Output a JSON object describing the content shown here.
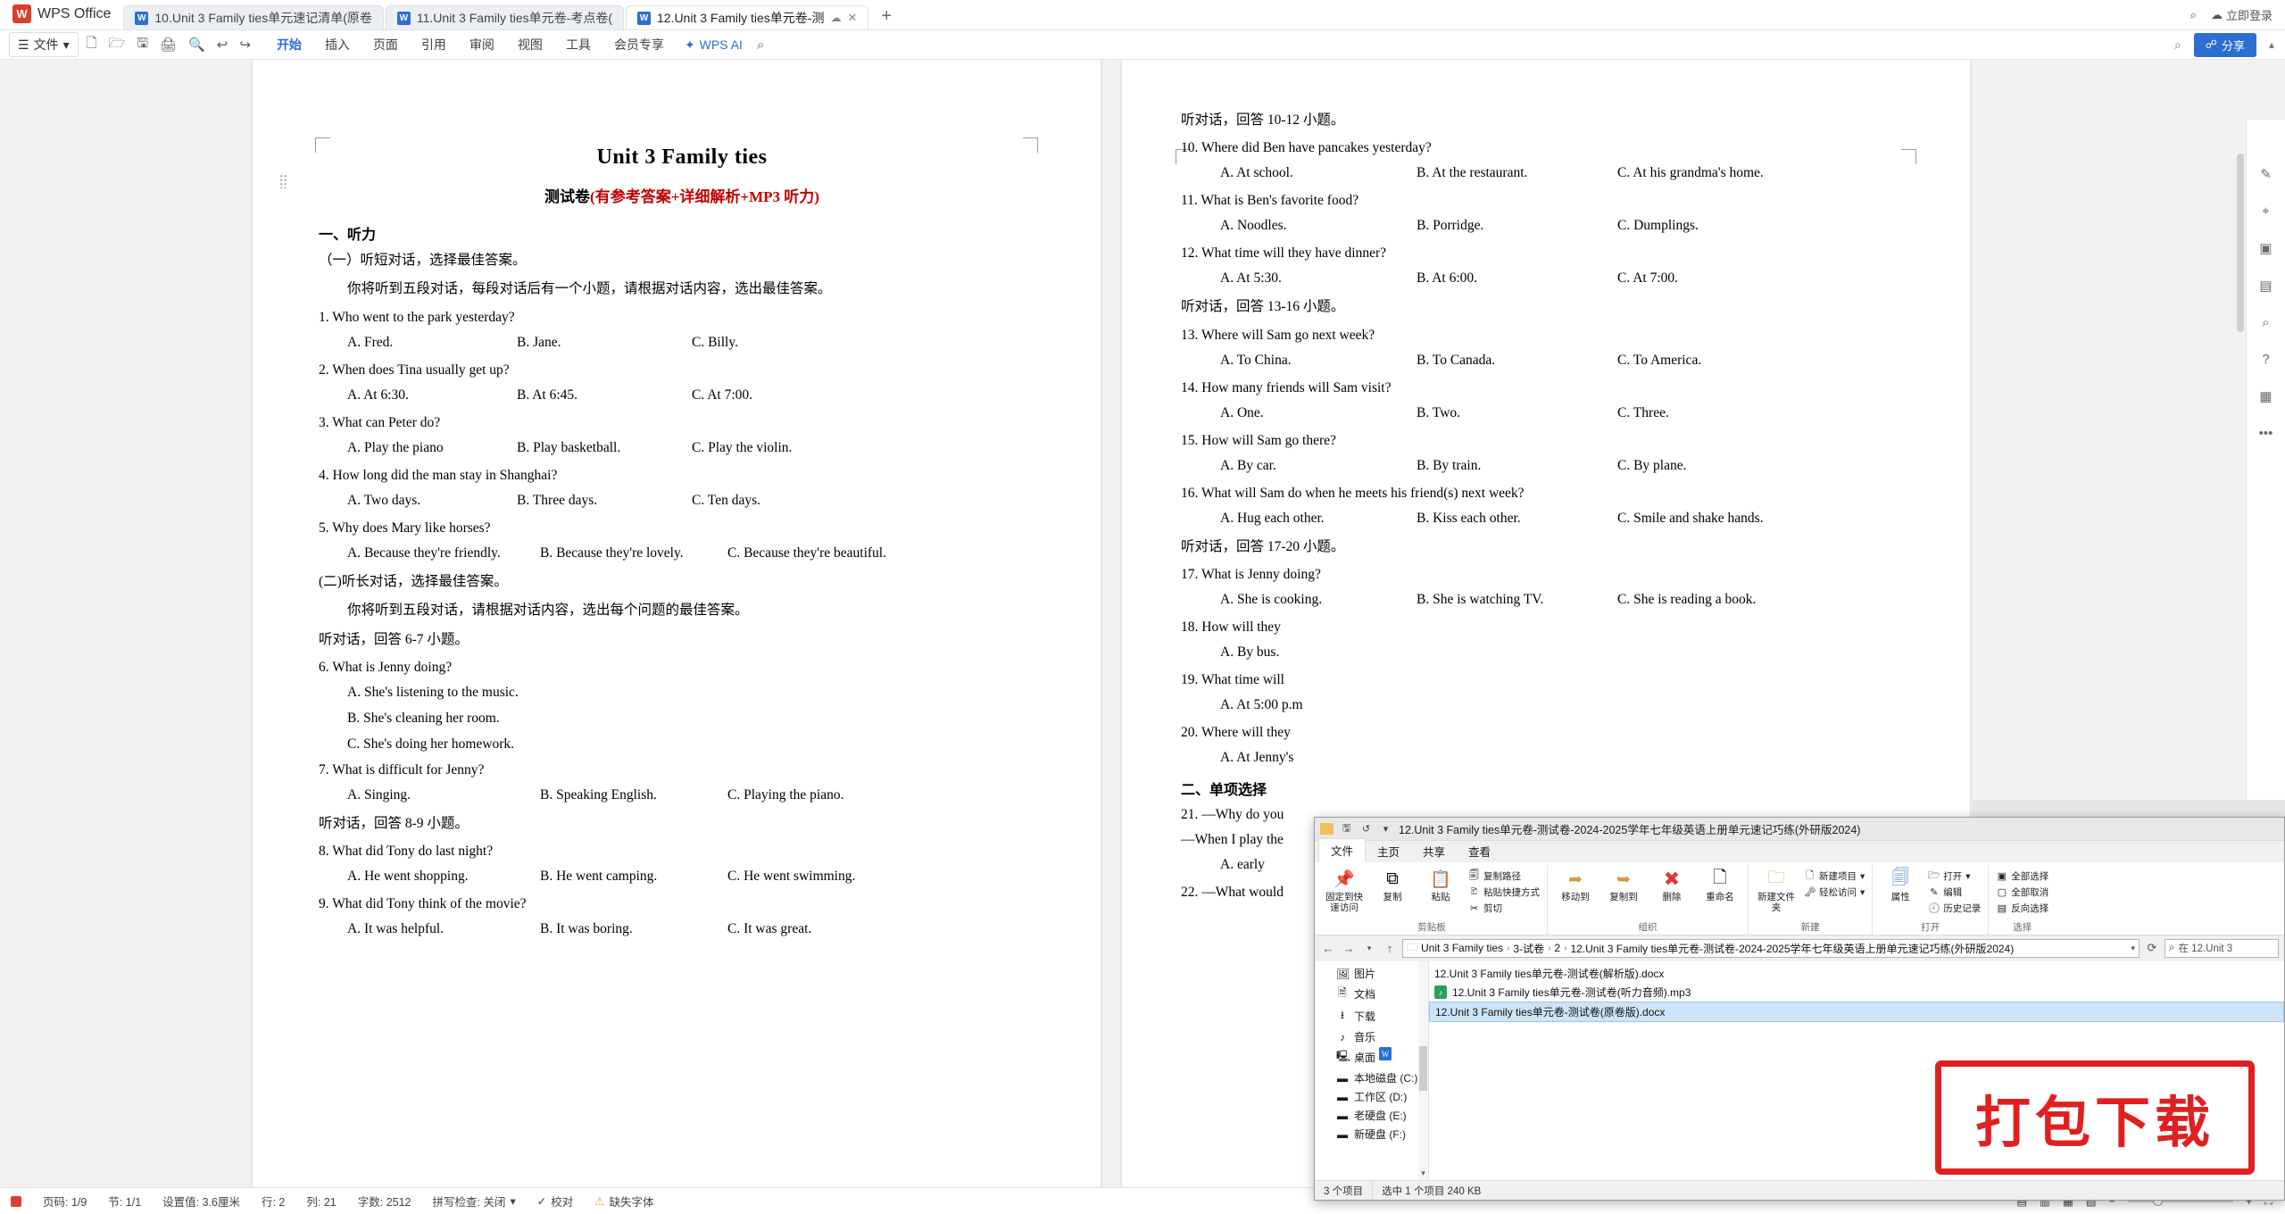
{
  "app": {
    "name": "WPS Office",
    "logo_letter": "W"
  },
  "tabs": [
    {
      "label": "10.Unit 3 Family ties单元速记清单(原卷",
      "icon": "word-doc-icon",
      "active": false
    },
    {
      "label": "11.Unit 3 Family ties单元卷-考点卷(",
      "icon": "word-doc-icon",
      "active": false
    },
    {
      "label": "12.Unit 3 Family ties单元卷-测",
      "icon": "word-doc-icon",
      "active": true
    }
  ],
  "tab_add": "+",
  "titlebar_right": {
    "search_icon": "search-icon",
    "user_icon": "user-icon",
    "upgrade": "立即登录"
  },
  "ribbon": {
    "file_menu": "文件",
    "quick_access": [
      "new-icon",
      "open-icon",
      "save-icon",
      "print-icon",
      "print-preview-icon",
      "undo-icon",
      "redo-icon"
    ],
    "menu_items": [
      {
        "label": "开始",
        "selected": true
      },
      {
        "label": "插入",
        "selected": false
      },
      {
        "label": "页面",
        "selected": false
      },
      {
        "label": "引用",
        "selected": false
      },
      {
        "label": "审阅",
        "selected": false
      },
      {
        "label": "视图",
        "selected": false
      },
      {
        "label": "工具",
        "selected": false
      },
      {
        "label": "会员专享",
        "selected": false
      }
    ],
    "wps_ai": "WPS AI",
    "search_icon": "search-icon",
    "help_icon": "help-icon",
    "share_label": "分享",
    "collapse_icon": "chevron-up-icon"
  },
  "document": {
    "title": "Unit 3 Family ties",
    "subtitle_main": "测试卷",
    "subtitle_paren": "(有参考答案+详细解析+MP3 听力)",
    "section1": "一、听力",
    "part1": "（一）听短对话，选择最佳答案。",
    "part1_note": "你将听到五段对话，每段对话后有一个小题，请根据对话内容，选出最佳答案。",
    "questions_left": [
      {
        "q": "1. Who went to the park yesterday?",
        "a": "A. Fred.",
        "b": "B. Jane.",
        "c": "C. Billy."
      },
      {
        "q": "2. When does Tina usually get up?",
        "a": "A. At 6:30.",
        "b": "B. At 6:45.",
        "c": "C. At 7:00."
      },
      {
        "q": "3. What can Peter do?",
        "a": "A. Play the piano",
        "b": "B. Play basketball.",
        "c": "C. Play the violin."
      },
      {
        "q": "4. How long did the man stay in Shanghai?",
        "a": "A. Two days.",
        "b": "B. Three days.",
        "c": "C. Ten days."
      },
      {
        "q": "5. Why does Mary like horses?",
        "a": "A. Because they're friendly.",
        "b": "B. Because they're lovely.",
        "c": "C. Because they're beautiful."
      }
    ],
    "part2": "(二)听长对话，选择最佳答案。",
    "part2_note": "你将听到五段对话，请根据对话内容，选出每个问题的最佳答案。",
    "listen_6_7": "听对话，回答 6-7 小题。",
    "q6": "6. What is Jenny doing?",
    "q6_a": "A. She's listening to the music.",
    "q6_b": "B. She's cleaning her room.",
    "q6_c": "C. She's doing her homework.",
    "q7": "7. What is difficult for Jenny?",
    "q7_a": "A. Singing.",
    "q7_b": "B. Speaking English.",
    "q7_c": "C. Playing the piano.",
    "listen_8_9": "听对话，回答 8-9 小题。",
    "q8": "8. What did Tony do last night?",
    "q8_a": "A. He went shopping.",
    "q8_b": "B. He went camping.",
    "q8_c": "C. He went swimming.",
    "q9": "9. What did Tony think of the movie?",
    "q9_a": "A. It was helpful.",
    "q9_b": "B. It was boring.",
    "q9_c": "C. It was great."
  },
  "document_right": {
    "listen_10_12": "听对话，回答 10-12 小题。",
    "q10": "10. Where did Ben have pancakes yesterday?",
    "q10_a": "A. At school.",
    "q10_b": "B. At the restaurant.",
    "q10_c": "C. At his grandma's home.",
    "q11": "11. What is Ben's favorite food?",
    "q11_a": "A. Noodles.",
    "q11_b": "B. Porridge.",
    "q11_c": "C. Dumplings.",
    "q12": "12. What time will they have dinner?",
    "q12_a": "A. At 5:30.",
    "q12_b": "B. At 6:00.",
    "q12_c": "C. At 7:00.",
    "listen_13_16": "听对话，回答 13-16 小题。",
    "q13": "13. Where will Sam go next week?",
    "q13_a": "A. To China.",
    "q13_b": "B. To Canada.",
    "q13_c": "C. To America.",
    "q14": "14. How many friends will Sam visit?",
    "q14_a": "A. One.",
    "q14_b": "B. Two.",
    "q14_c": "C. Three.",
    "q15": "15. How will Sam go there?",
    "q15_a": "A. By car.",
    "q15_b": "B. By train.",
    "q15_c": "C. By plane.",
    "q16": "16. What will Sam do when he meets his friend(s) next week?",
    "q16_a": "A. Hug each other.",
    "q16_b": "B. Kiss each other.",
    "q16_c": "C. Smile and shake hands.",
    "listen_17_20": "听对话，回答 17-20 小题。",
    "q17": "17. What is Jenny doing?",
    "q17_a": "A. She is cooking.",
    "q17_b": "B. She is watching TV.",
    "q17_c": "C. She is reading a book.",
    "q18": "18. How will they",
    "q18_a": "A. By bus.",
    "q19": "19. What time will",
    "q19_a": "A. At 5:00 p.m",
    "q20": "20. Where will they",
    "q20_a": "A. At Jenny's",
    "section2": "二、单项选择",
    "q21": "21. —Why do you",
    "q21b": "—When I play the",
    "q21_a": "A. early",
    "q22": "22. —What would"
  },
  "right_rail": {
    "icons": [
      "pen-icon",
      "cursor-icon",
      "comment-icon",
      "layers-icon",
      "find-icon",
      "help-icon",
      "image-icon",
      "more-icon"
    ]
  },
  "statusbar": {
    "page_icon": "page-red-icon",
    "page_label": "页码: 1/9",
    "section": "节: 1/1",
    "position": "设置值: 3.6厘米",
    "row": "行: 2",
    "col": "列: 21",
    "word_count": "字数: 2512",
    "spellcheck": "拼写检查: 关闭",
    "proof": "校对",
    "missing_font": "缺失字体",
    "view_icons": [
      "page-view-icon",
      "web-view-icon",
      "outline-view-icon",
      "reading-view-icon"
    ],
    "zoom_out": "−",
    "zoom_in": "+",
    "zoom_value": "",
    "fit_icon": "fit-page-icon"
  },
  "explorer": {
    "title": "12.Unit 3 Family ties单元卷-测试卷-2024-2025学年七年级英语上册单元速记巧练(外研版2024)",
    "quick_icons": [
      "folder-icon",
      "save-icon",
      "undo-icon",
      "dropdown-icon"
    ],
    "tabs": [
      {
        "label": "文件",
        "selected": true
      },
      {
        "label": "主页",
        "selected": false
      },
      {
        "label": "共享",
        "selected": false
      },
      {
        "label": "查看",
        "selected": false
      }
    ],
    "ribbon_groups": [
      {
        "name": "剪贴板",
        "big": [
          {
            "label": "固定到快速访问",
            "icon": "pin-icon"
          },
          {
            "label": "复制",
            "icon": "copy-icon"
          },
          {
            "label": "粘贴",
            "icon": "paste-icon"
          }
        ],
        "small": [
          {
            "label": "复制路径",
            "icon": "copy-path-icon"
          },
          {
            "label": "粘贴快捷方式",
            "icon": "paste-shortcut-icon"
          },
          {
            "label": "剪切",
            "icon": "scissors-icon"
          }
        ]
      },
      {
        "name": "组织",
        "big": [
          {
            "label": "移动到",
            "icon": "move-to-icon"
          },
          {
            "label": "复制到",
            "icon": "copy-to-icon"
          },
          {
            "label": "删除",
            "icon": "delete-icon"
          },
          {
            "label": "重命名",
            "icon": "rename-icon"
          }
        ],
        "small": []
      },
      {
        "name": "新建",
        "big": [
          {
            "label": "新建文件夹",
            "icon": "new-folder-icon"
          }
        ],
        "small": [
          {
            "label": "新建项目",
            "icon": "new-item-icon"
          },
          {
            "label": "轻松访问",
            "icon": "easy-access-icon"
          }
        ]
      },
      {
        "name": "打开",
        "big": [
          {
            "label": "属性",
            "icon": "properties-icon"
          }
        ],
        "small": [
          {
            "label": "打开",
            "icon": "open-icon"
          },
          {
            "label": "编辑",
            "icon": "edit-icon"
          },
          {
            "label": "历史记录",
            "icon": "history-icon"
          }
        ]
      },
      {
        "name": "选择",
        "big": [],
        "small": [
          {
            "label": "全部选择",
            "icon": "select-all-icon"
          },
          {
            "label": "全部取消",
            "icon": "select-none-icon"
          },
          {
            "label": "反向选择",
            "icon": "invert-selection-icon"
          }
        ]
      }
    ],
    "nav": {
      "back_icon": "back-arrow-icon",
      "forward_icon": "forward-arrow-icon",
      "recent_icon": "recent-dropdown-icon",
      "up_icon": "up-arrow-icon",
      "breadcrumbs": [
        "Unit 3 Family ties",
        "3-试卷",
        "2",
        "12.Unit 3 Family ties单元卷-测试卷-2024-2025学年七年级英语上册单元速记巧练(外研版2024)"
      ],
      "dropdown_icon": "chevron-down-icon",
      "refresh_icon": "refresh-icon",
      "search_placeholder": "在 12.Unit 3"
    },
    "nav_pane": [
      {
        "label": "图片",
        "icon": "pictures-icon"
      },
      {
        "label": "文档",
        "icon": "documents-icon"
      },
      {
        "label": "下载",
        "icon": "downloads-icon"
      },
      {
        "label": "音乐",
        "icon": "music-icon"
      },
      {
        "label": "桌面",
        "icon": "desktop-icon"
      },
      {
        "label": "本地磁盘 (C:)",
        "icon": "drive-icon"
      },
      {
        "label": "工作区 (D:)",
        "icon": "drive-icon"
      },
      {
        "label": "老硬盘 (E:)",
        "icon": "drive-icon"
      },
      {
        "label": "新硬盘 (F:)",
        "icon": "drive-icon"
      }
    ],
    "files": [
      {
        "name": "12.Unit 3 Family ties单元卷-测试卷(解析版).docx",
        "type": "docx",
        "selected": false
      },
      {
        "name": "12.Unit 3 Family ties单元卷-测试卷(听力音频).mp3",
        "type": "mp3",
        "selected": false
      },
      {
        "name": "12.Unit 3 Family ties单元卷-测试卷(原卷版).docx",
        "type": "docx",
        "selected": true
      }
    ],
    "status": {
      "count": "3 个项目",
      "selection": "选中 1 个项目 240 KB"
    }
  },
  "stamp": {
    "text": "打包下载",
    "color": "#e02020"
  }
}
